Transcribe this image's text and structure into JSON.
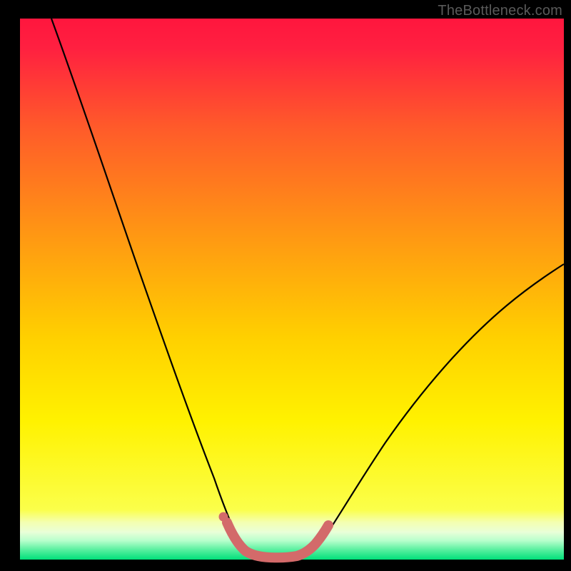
{
  "watermark": "TheBottleneck.com",
  "chart_data": {
    "type": "line",
    "title": "",
    "xlabel": "",
    "ylabel": "",
    "xlim": [
      0,
      100
    ],
    "ylim": [
      0,
      100
    ],
    "grid": false,
    "series": [
      {
        "name": "bottleneck-curve",
        "x": [
          6,
          10,
          14,
          18,
          22,
          26,
          30,
          34,
          36,
          38,
          39,
          40,
          41,
          42,
          44,
          46,
          48,
          50,
          52,
          55,
          60,
          65,
          70,
          75,
          80,
          85,
          90,
          95,
          100
        ],
        "y": [
          100,
          88,
          77,
          66,
          55,
          44,
          33,
          20,
          12,
          6,
          3,
          1,
          0.5,
          0.5,
          0.5,
          0.5,
          1,
          2,
          4,
          7,
          13,
          19,
          25,
          31,
          37,
          42,
          47,
          51,
          55
        ]
      },
      {
        "name": "optimal-zone-marker",
        "x": [
          36,
          37,
          38,
          39,
          40,
          41,
          42,
          43,
          44,
          45,
          46,
          47,
          48,
          49,
          50
        ],
        "y": [
          4,
          2.5,
          1.5,
          1,
          0.8,
          0.7,
          0.7,
          0.7,
          0.7,
          0.8,
          1,
          1.3,
          1.7,
          2.2,
          3
        ]
      }
    ],
    "background_gradient": {
      "top": "#ff1a3a",
      "mid_upper": "#ff8a00",
      "mid": "#ffe600",
      "mid_lower": "#f0ff5a",
      "bottom": "#00e57a"
    },
    "colors": {
      "curve": "#000000",
      "marker": "#d86a6a",
      "frame": "#000000"
    }
  }
}
